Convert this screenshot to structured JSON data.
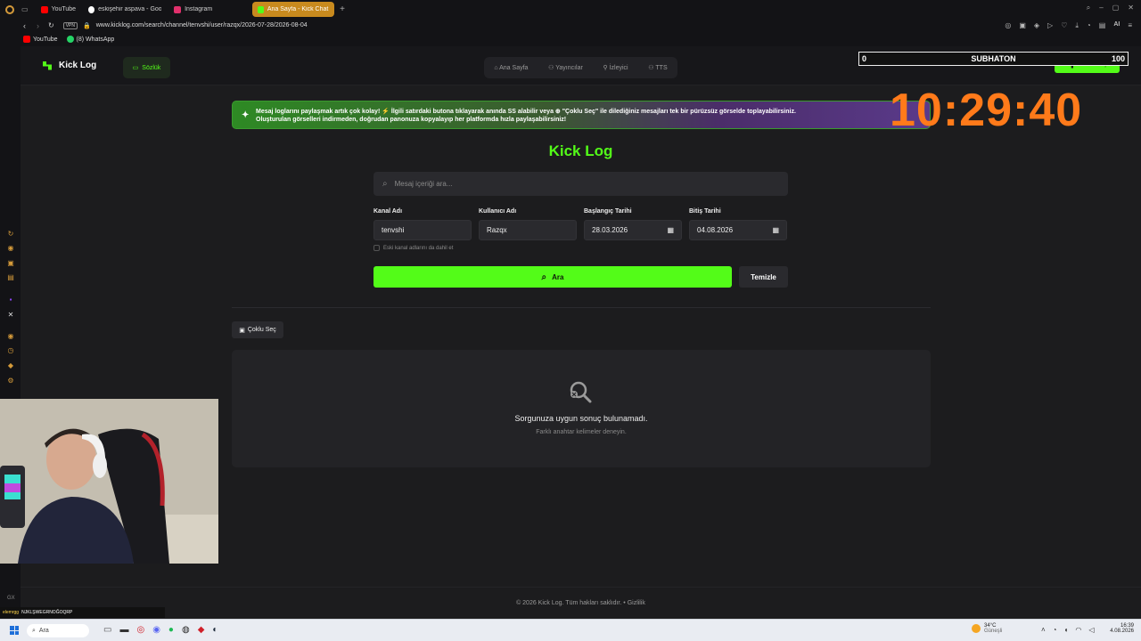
{
  "browser": {
    "tabs": [
      {
        "label": "YouTube",
        "color": "#ff0000"
      },
      {
        "label": "eskişehir aspava - Google",
        "color": "#ffffff"
      },
      {
        "label": "Instagram",
        "color": "#e1306c"
      },
      {
        "label": "Ana Sayfa - Kick Chat Log",
        "color": "#53fc18",
        "active": true
      }
    ],
    "url": "www.kicklog.com/search/channel/tenvshi/user/razqx/2026-07-28/2026-08-04",
    "vpn_label": "VPN",
    "bookmarks": [
      "YouTube",
      "(8) WhatsApp"
    ],
    "ai_label": "AI"
  },
  "site": {
    "brand": "Kick Log",
    "dictionary_button": "Sözlük",
    "nav": [
      "Ana Sayfa",
      "Yayıncılar",
      "İzleyici",
      "TTS"
    ],
    "login_button": "Kick ile Giriş",
    "banner_line1": "Mesaj loglarını paylaşmak artık çok kolay! ⚡ İlgili satırdaki butona tıklayarak anında SS alabilir veya ⊕ \"Çoklu Seç\" ile dilediğiniz mesajları tek bir pürüzsüz görselde toplayabilirsiniz.",
    "banner_line2": "Oluşturulan görselleri indirmeden, doğrudan panonuza kopyalayıp her platformda hızla paylaşabilirsiniz!",
    "page_title": "Kick Log",
    "search_placeholder": "Mesaj içeriği ara...",
    "fields": {
      "channel_label": "Kanal Adı",
      "channel_value": "tenvshi",
      "user_label": "Kullanıcı Adı",
      "user_value": "Razqx",
      "start_label": "Başlangıç Tarihi",
      "start_value": "28.03.2026",
      "end_label": "Bitiş Tarihi",
      "end_value": "04.08.2026"
    },
    "old_names_checkbox": "Eski kanal adlarını da dahil et",
    "search_button": "Ara",
    "clear_button": "Temizle",
    "multi_select_button": "Çoklu Seç",
    "empty_title": "Sorgunuza uygun sonuç bulunamadı.",
    "empty_subtitle": "Farklı anahtar kelimeler deneyin.",
    "footer": "© 2026 Kick Log. Tüm hakları saklıdır.",
    "footer_privacy": "Gizlilik"
  },
  "overlay": {
    "subhaton_left": "0",
    "subhaton_title": "SUBHATON",
    "subhaton_right": "100",
    "clock": "10:29:40"
  },
  "stream_bottom": {
    "chat_line": "NJKLŞWEGRNOĞOQRP",
    "chat_user": "elemrgg"
  },
  "taskbar": {
    "search_label": "Ara",
    "weather_temp": "34°C",
    "weather_desc": "Güneşli",
    "time": "16:39",
    "date": "4.08.2026"
  },
  "colors": {
    "accent": "#53fc18",
    "clock": "#ff7a1a",
    "tab_active": "#c88a1e"
  }
}
